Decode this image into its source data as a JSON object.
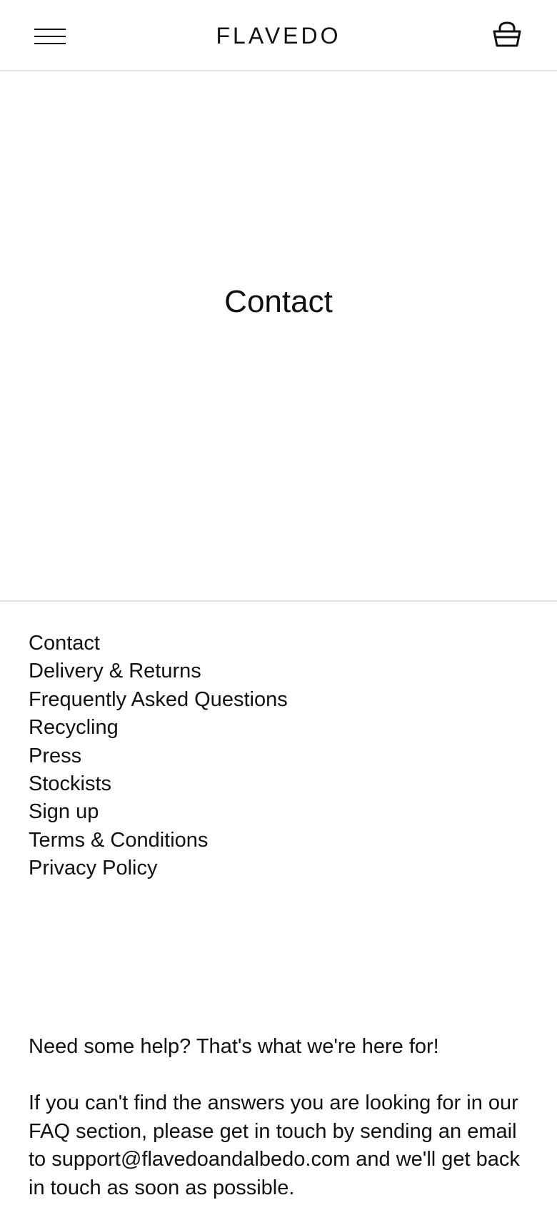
{
  "header": {
    "logo": "FLAVEDO",
    "menu_icon": "hamburger-menu-icon",
    "cart_icon": "shopping-basket-icon"
  },
  "main": {
    "title": "Contact"
  },
  "footer": {
    "links": [
      "Contact",
      "Delivery & Returns",
      "Frequently Asked Questions",
      "Recycling",
      "Press",
      "Stockists",
      "Sign up",
      "Terms & Conditions",
      "Privacy Policy"
    ],
    "help_heading": "Need some help? That's what we're here for!",
    "help_body": "If you can't find the answers you are looking for in our FAQ section, please get in touch by sending an email to support@flavedoandalbedo.com and we'll get back in touch as soon as possible."
  }
}
